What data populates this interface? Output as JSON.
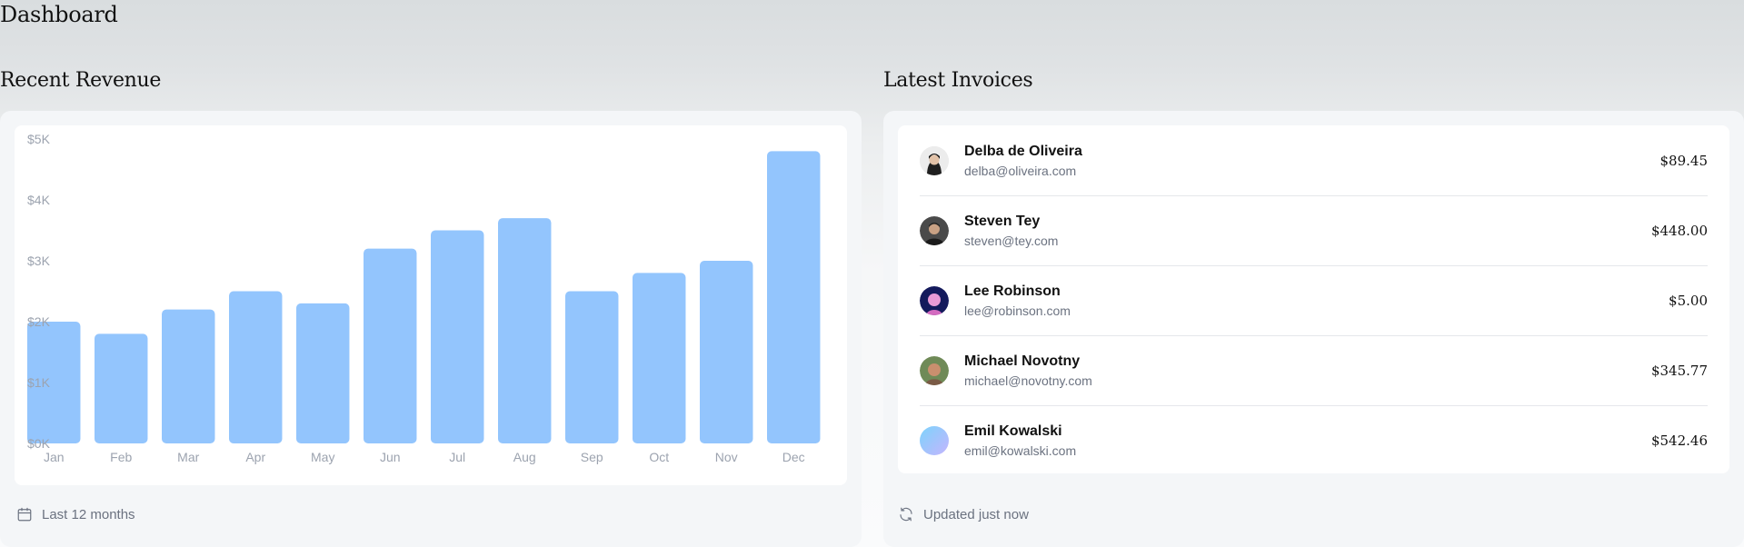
{
  "page": {
    "title": "Dashboard"
  },
  "revenue": {
    "title": "Recent Revenue",
    "footer": "Last 12 months",
    "footer_icon": "calendar-icon"
  },
  "chart_data": {
    "type": "bar",
    "categories": [
      "Jan",
      "Feb",
      "Mar",
      "Apr",
      "May",
      "Jun",
      "Jul",
      "Aug",
      "Sep",
      "Oct",
      "Nov",
      "Dec"
    ],
    "values": [
      2000,
      1800,
      2200,
      2500,
      2300,
      3200,
      3500,
      3700,
      2500,
      2800,
      3000,
      4800
    ],
    "ylim": [
      0,
      5000
    ],
    "yticks": [
      "$5K",
      "$4K",
      "$3K",
      "$2K",
      "$1K",
      "$0K"
    ],
    "bar_color": "#93c5fd",
    "grid": false
  },
  "invoices": {
    "title": "Latest Invoices",
    "footer": "Updated just now",
    "footer_icon": "refresh-icon",
    "items": [
      {
        "name": "Delba de Oliveira",
        "email": "delba@oliveira.com",
        "amount": "$89.45"
      },
      {
        "name": "Steven Tey",
        "email": "steven@tey.com",
        "amount": "$448.00"
      },
      {
        "name": "Lee Robinson",
        "email": "lee@robinson.com",
        "amount": "$5.00"
      },
      {
        "name": "Michael Novotny",
        "email": "michael@novotny.com",
        "amount": "$345.77"
      },
      {
        "name": "Emil Kowalski",
        "email": "emil@kowalski.com",
        "amount": "$542.46"
      }
    ]
  }
}
